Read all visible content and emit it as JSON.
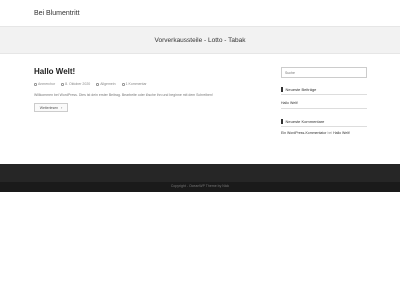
{
  "header": {
    "site_title": "Bei Blumentritt"
  },
  "banner": {
    "tagline": "Vorverkaussteile - Lotto - Tabak"
  },
  "post": {
    "title": "Hallo Welt!",
    "meta": {
      "author": "Anmerchor",
      "date": "8. Oktober 2020",
      "category": "Allgemein",
      "comments": "1 Kommentar"
    },
    "excerpt": "Willkommen bei WordPress. Dies ist dein erster Beitrag. Bearbeite oder lösche ihn und beginne mit dem Schreiben!",
    "read_more": "Weiterlesen"
  },
  "sidebar": {
    "search_placeholder": "Suche",
    "recent_posts_title": "Neueste Beiträge",
    "recent_posts": [
      "Hallo Welt!"
    ],
    "recent_comments_title": "Neueste Kommentare",
    "recent_comment": {
      "author": "Ein WordPress-Kommentator",
      "connector": "bei",
      "post": "Hallo Welt!"
    }
  },
  "footer": {
    "copyright": "Copyright - OceanWP Theme by Nick"
  },
  "colors": {
    "banner_bg": "#f2f2f2",
    "footer_bg": "#262626"
  }
}
